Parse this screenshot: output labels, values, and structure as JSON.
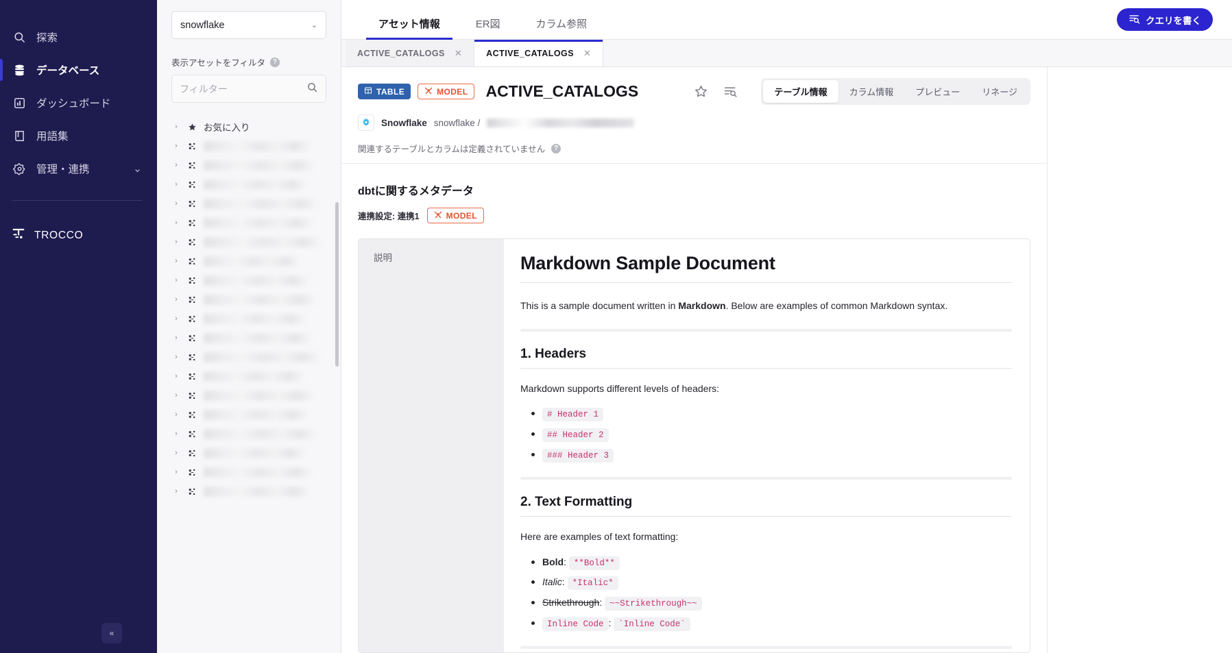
{
  "leftnav": {
    "items": [
      {
        "label": "探索",
        "icon": "search-icon",
        "active": false
      },
      {
        "label": "データベース",
        "icon": "database-icon",
        "active": true
      },
      {
        "label": "ダッシュボード",
        "icon": "dashboard-icon",
        "active": false
      },
      {
        "label": "用語集",
        "icon": "book-icon",
        "active": false
      },
      {
        "label": "管理・連携",
        "icon": "gear-icon",
        "active": false,
        "chevron": "⌄"
      }
    ],
    "brand": "TROCCO",
    "collapse_glyph": "«"
  },
  "assetpanel": {
    "connection": "snowflake",
    "connection_chevron": "⌄",
    "filter_section_label": "表示アセットをフィルタ",
    "help_glyph": "?",
    "filter_placeholder": "フィルター",
    "favorites_label": "お気に入り",
    "favorites_chevron": "›",
    "blurred_rows": 19
  },
  "topbar": {
    "tabs": [
      {
        "label": "アセット情報",
        "active": true
      },
      {
        "label": "ER図",
        "active": false
      },
      {
        "label": "カラム参照",
        "active": false
      }
    ],
    "query_button": "クエリを書く",
    "query_icon": "query-search-icon"
  },
  "doctabs": [
    {
      "label": "ACTIVE_CATALOGS",
      "active": false,
      "close": "✕"
    },
    {
      "label": "ACTIVE_CATALOGS",
      "active": true,
      "close": "✕"
    }
  ],
  "asset": {
    "badge_table": "TABLE",
    "badge_table_icon": "table-icon",
    "badge_model": "MODEL",
    "badge_model_icon": "dbt-icon",
    "name": "ACTIVE_CATALOGS",
    "star_icon": "star-outline-icon",
    "list_search_icon": "list-search-icon",
    "view_tabs": [
      {
        "label": "テーブル情報",
        "active": true
      },
      {
        "label": "カラム情報",
        "active": false
      },
      {
        "label": "プレビュー",
        "active": false
      },
      {
        "label": "リネージ",
        "active": false
      }
    ],
    "source_logo_icon": "snowflake-icon",
    "source_name": "Snowflake",
    "source_path_prefix": "snowflake /",
    "source_path_redacted": true,
    "no_relation_text": "関連するテーブルとカラムは定義されていません",
    "no_relation_help": "?"
  },
  "dbt": {
    "title": "dbtに関するメタデータ",
    "integration_label": "連携設定: 連携1",
    "badge_model": "MODEL",
    "badge_model_icon": "dbt-icon"
  },
  "description": {
    "side_label": "説明",
    "doc": {
      "h1": "Markdown Sample Document",
      "intro_before": "This is a sample document written in ",
      "intro_bold": "Markdown",
      "intro_after": ". Below are examples of common Markdown syntax.",
      "section1_heading": "1. Headers",
      "section1_text": "Markdown supports different levels of headers:",
      "section1_items": [
        "# Header 1",
        "## Header 2",
        "### Header 3"
      ],
      "section2_heading": "2. Text Formatting",
      "section2_text": "Here are examples of text formatting:",
      "section2_items": [
        {
          "style": "bold",
          "label": "Bold",
          "sep": ":",
          "code": "**Bold**"
        },
        {
          "style": "italic",
          "label": "Italic",
          "sep": ":",
          "code": "*Italic*"
        },
        {
          "style": "strike",
          "label": "Strikethrough",
          "sep": ":",
          "code": "~~Strikethrough~~"
        },
        {
          "style": "code",
          "label": "Inline Code",
          "sep": ":",
          "code": "`Inline Code`"
        }
      ]
    }
  },
  "colors": {
    "nav_bg": "#1e1b4f",
    "accent": "#2b24cf",
    "badge_table": "#2f62ad",
    "badge_model": "#e3512c",
    "code_text": "#c7336b",
    "panel_bg": "#f7f7f9"
  }
}
